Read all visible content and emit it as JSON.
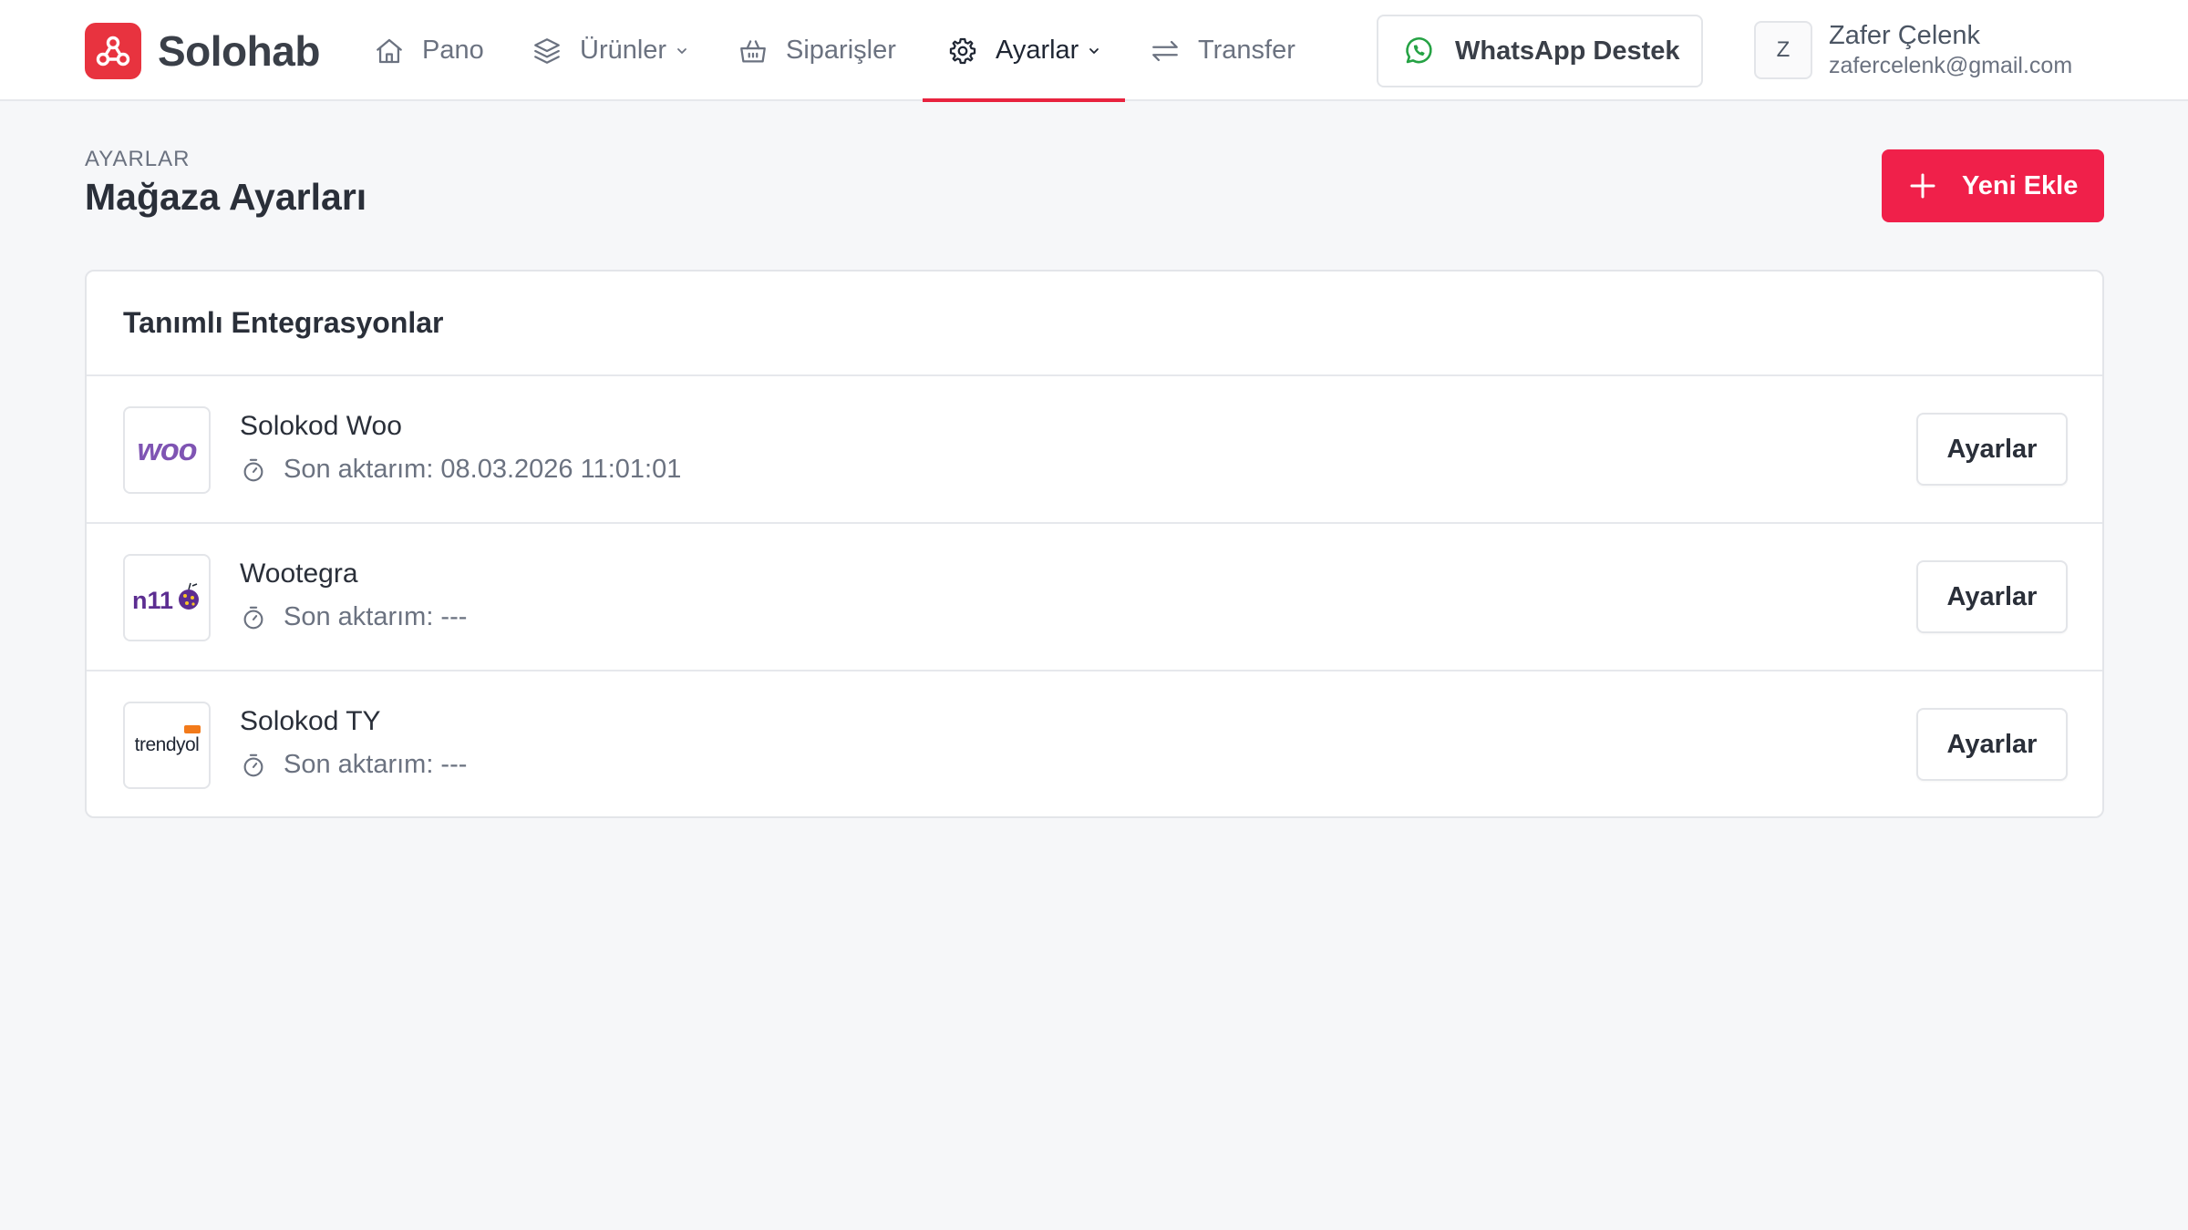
{
  "app": {
    "name": "Solohab",
    "colors": {
      "brand": "#e8333f",
      "accent": "#f0204a",
      "whatsapp": "#25a244",
      "woo": "#7f54b3",
      "n11": "#5c2d91"
    }
  },
  "nav": {
    "items": [
      {
        "label": "Pano",
        "icon": "home-icon"
      },
      {
        "label": "Ürünler",
        "icon": "layers-icon",
        "dropdown": true
      },
      {
        "label": "Siparişler",
        "icon": "basket-icon"
      },
      {
        "label": "Ayarlar",
        "icon": "gear-icon",
        "dropdown": true,
        "active": true
      },
      {
        "label": "Transfer",
        "icon": "transfer-icon"
      }
    ]
  },
  "support": {
    "label": "WhatsApp Destek",
    "icon": "whatsapp-icon"
  },
  "user": {
    "initial": "Z",
    "name": "Zafer Çelenk",
    "email": "zafercelenk@gmail.com"
  },
  "header": {
    "eyebrow": "AYARLAR",
    "title": "Mağaza Ayarları",
    "new_button": "Yeni Ekle"
  },
  "integrations": {
    "title": "Tanımlı Entegrasyonlar",
    "meta_label": "Son aktarım:",
    "button_label": "Ayarlar",
    "items": [
      {
        "name": "Solokod Woo",
        "last_transfer": "08.03.2026 11:01:01",
        "logo": "woo",
        "logo_text": "woo"
      },
      {
        "name": "Wootegra",
        "last_transfer": "---",
        "logo": "n11",
        "logo_text": "n11"
      },
      {
        "name": "Solokod TY",
        "last_transfer": "---",
        "logo": "trendyol",
        "logo_text": "trendyol"
      }
    ]
  }
}
